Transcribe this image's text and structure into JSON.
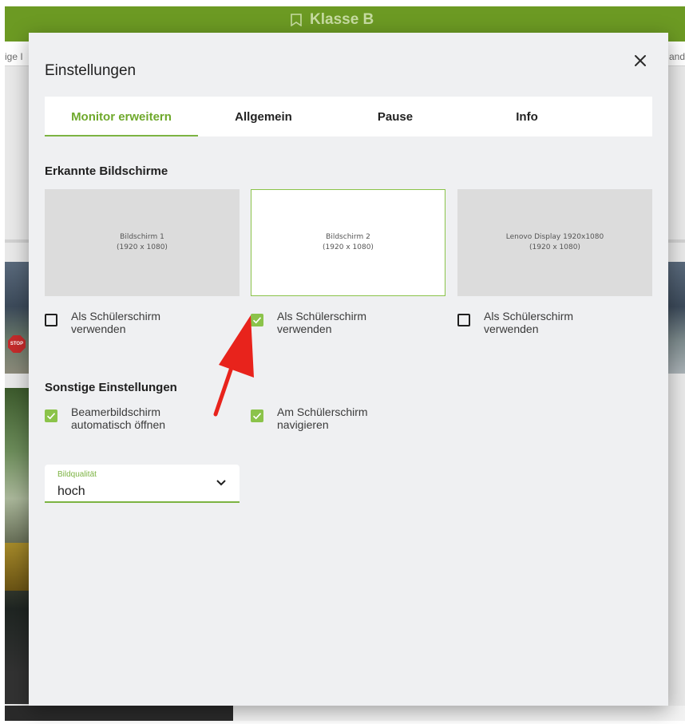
{
  "background": {
    "app_title": "Klasse B",
    "left_partial_text": "ige I",
    "right_partial_text": "and",
    "stop_sign_text": "STOP"
  },
  "dialog": {
    "title": "Einstellungen",
    "close_icon": "close-icon",
    "tabs": [
      {
        "label": "Monitor erweitern",
        "active": true
      },
      {
        "label": "Allgemein",
        "active": false
      },
      {
        "label": "Pause",
        "active": false
      },
      {
        "label": "Info",
        "active": false
      }
    ],
    "detected_screens_title": "Erkannte Bildschirme",
    "monitors": [
      {
        "name": "Bildschirm 1",
        "resolution": "(1920 x 1080)",
        "selected": false,
        "checkbox_line1": "Als Schülerschirm",
        "checkbox_line2": "verwenden",
        "checked": false
      },
      {
        "name": "Bildschirm 2",
        "resolution": "(1920 x 1080)",
        "selected": true,
        "checkbox_line1": "Als Schülerschirm",
        "checkbox_line2": "verwenden",
        "checked": true
      },
      {
        "name": "Lenovo Display 1920x1080",
        "resolution": "(1920 x 1080)",
        "selected": false,
        "checkbox_line1": "Als Schülerschirm",
        "checkbox_line2": "verwenden",
        "checked": false
      }
    ],
    "other_settings_title": "Sonstige Einstellungen",
    "other_settings": [
      {
        "line1": "Beamerbildschirm",
        "line2": "automatisch öffnen",
        "checked": true
      },
      {
        "line1": "Am Schülerschirm",
        "line2": "navigieren",
        "checked": true
      }
    ],
    "image_quality": {
      "label": "Bildqualität",
      "value": "hoch",
      "chevron_icon": "chevron-down-icon"
    }
  },
  "colors": {
    "accent": "#7cb342",
    "app_bar": "#6c9a23",
    "annotation_arrow": "#e8231c"
  }
}
